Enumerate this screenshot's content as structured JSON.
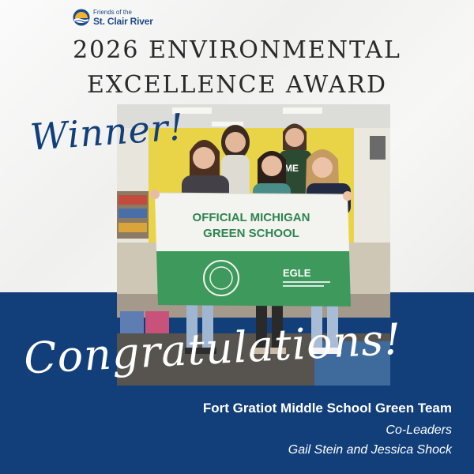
{
  "logo": {
    "line1": "Friends of the",
    "line2": "St. Clair River",
    "icon": "sun-over-water-logo"
  },
  "title": {
    "line1": "2026 ENVIRONMENTAL",
    "line2": "EXCELLENCE AWARD"
  },
  "winner_text": "Winner!",
  "photo": {
    "flag_line1": "OFFICIAL MICHIGAN",
    "flag_line2": "GREEN SCHOOL",
    "flag_logo": "EGLE"
  },
  "congrats_text": "Congratulations!",
  "team_name": "Fort Gratiot Middle School Green Team",
  "coleaders_label": "Co-Leaders",
  "leaders_names": "Gail Stein and Jessica Shock",
  "colors": {
    "navy": "#123f7a",
    "background": "#f4f4f3",
    "flag_green": "#3e9a5c"
  }
}
